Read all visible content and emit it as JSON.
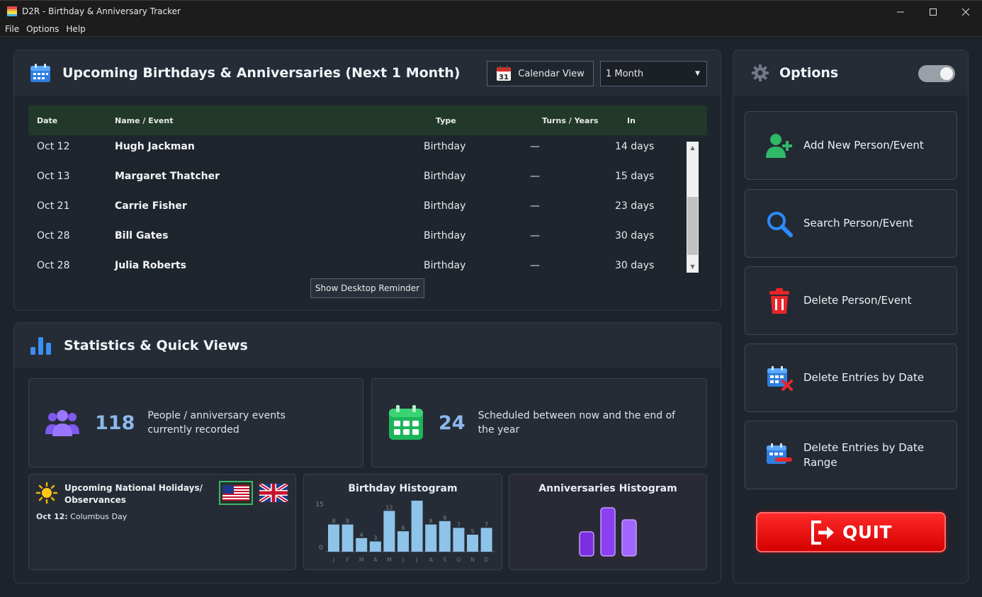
{
  "window": {
    "title": "D2R - Birthday & Anniversary Tracker"
  },
  "menu": {
    "items": [
      "File",
      "Options",
      "Help"
    ]
  },
  "upcoming": {
    "title": "Upcoming Birthdays & Anniversaries (Next 1 Month)",
    "calendar_view_label": "Calendar View",
    "range_value": "1 Month",
    "columns": {
      "date": "Date",
      "name": "Name / Event",
      "type": "Type",
      "turns": "Turns / Years",
      "in": "In"
    },
    "rows": [
      {
        "date": "Oct 12",
        "name": "Hugh Jackman",
        "type": "Birthday",
        "turns": "—",
        "in": "14 days"
      },
      {
        "date": "Oct 13",
        "name": "Margaret Thatcher",
        "type": "Birthday",
        "turns": "—",
        "in": "15 days"
      },
      {
        "date": "Oct 21",
        "name": "Carrie Fisher",
        "type": "Birthday",
        "turns": "—",
        "in": "23 days"
      },
      {
        "date": "Oct 28",
        "name": "Bill Gates",
        "type": "Birthday",
        "turns": "—",
        "in": "30 days"
      },
      {
        "date": "Oct 28",
        "name": "Julia Roberts",
        "type": "Birthday",
        "turns": "—",
        "in": "30 days"
      }
    ],
    "reminder_label": "Show Desktop Reminder"
  },
  "stats": {
    "title": "Statistics & Quick Views",
    "people": {
      "value": "118",
      "desc": "People / anniversary events currently recorded"
    },
    "scheduled": {
      "value": "24",
      "desc": "Scheduled between now and the end of the year"
    },
    "holidays": {
      "title": "Upcoming National Holidays/ Observances",
      "entry_date": "Oct 12:",
      "entry_name": "Columbus Day"
    }
  },
  "birthday_histogram": {
    "title": "Birthday Histogram",
    "y_max_label": "15",
    "y_min_label": "0",
    "months": [
      "J",
      "F",
      "M",
      "A",
      "M",
      "J",
      "J",
      "A",
      "S",
      "O",
      "N",
      "D"
    ],
    "values": [
      8,
      8,
      4,
      3,
      12,
      6,
      15,
      8,
      9,
      7,
      5,
      7
    ],
    "labels": [
      "8",
      "8",
      "4",
      "3",
      "12",
      "6",
      "",
      "8",
      "9",
      "7",
      "5",
      "7"
    ],
    "color": "#8ec3ea"
  },
  "anniversaries_histogram": {
    "title": "Anniversaries Histogram",
    "values": [
      2,
      4,
      3
    ],
    "color": "#8a3ff0"
  },
  "options": {
    "title": "Options",
    "add_label": "Add New Person/Event",
    "search_label": "Search Person/Event",
    "delete_label": "Delete Person/Event",
    "delete_date_label": "Delete Entries by Date",
    "delete_range_label": "Delete Entries by Date Range",
    "quit_label": "QUIT"
  }
}
